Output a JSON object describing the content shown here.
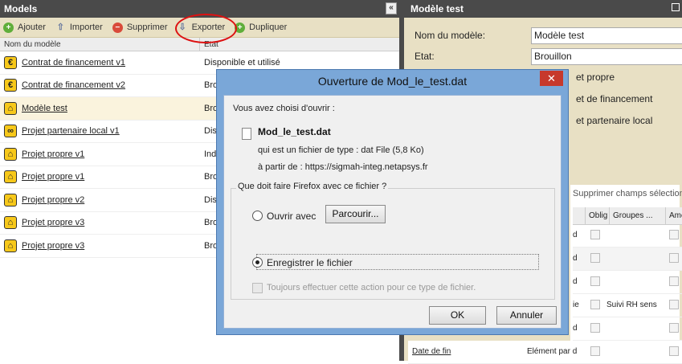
{
  "left_panel": {
    "title": "Models",
    "collapse_glyph": "«",
    "toolbar": [
      {
        "label": "Ajouter",
        "icon": "add-icon",
        "glyph": "+"
      },
      {
        "label": "Importer",
        "icon": "import-icon",
        "glyph": "⇧"
      },
      {
        "label": "Supprimer",
        "icon": "delete-icon",
        "glyph": "−"
      },
      {
        "label": "Exporter",
        "icon": "export-icon",
        "glyph": "⇩"
      },
      {
        "label": "Dupliquer",
        "icon": "duplicate-icon",
        "glyph": "+"
      }
    ],
    "columns": [
      "Nom du modèle",
      "Etat"
    ],
    "rows": [
      {
        "name": "Contrat de financement v1",
        "state": "Disponible et utilisé",
        "icon": "euro-icon",
        "glyph": "€"
      },
      {
        "name": "Contrat de financement v2",
        "state": "Brouillon",
        "icon": "euro-icon",
        "glyph": "€"
      },
      {
        "name": "Modèle test",
        "state": "Brouillon",
        "icon": "house-icon",
        "glyph": "⌂"
      },
      {
        "name": "Projet partenaire local v1",
        "state": "Disponible",
        "icon": "handshake-icon",
        "glyph": "∞"
      },
      {
        "name": "Projet propre v1",
        "state": "Indisponible",
        "icon": "house-icon",
        "glyph": "⌂"
      },
      {
        "name": "Projet propre v1",
        "state": "Brouillon",
        "icon": "house-icon",
        "glyph": "⌂"
      },
      {
        "name": "Projet propre v2",
        "state": "Disponible",
        "icon": "house-icon",
        "glyph": "⌂"
      },
      {
        "name": "Projet propre v3",
        "state": "Brouillon",
        "icon": "house-icon",
        "glyph": "⌂"
      },
      {
        "name": "Projet propre v3",
        "state": "Brouillon",
        "icon": "house-icon",
        "glyph": "⌂"
      }
    ]
  },
  "right_panel": {
    "title": "Modèle test",
    "name_label": "Nom du modèle:",
    "name_value": "Modèle test",
    "state_label": "Etat:",
    "state_value": "Brouillon",
    "type_options": [
      "et propre",
      "et de financement",
      "et partenaire local"
    ],
    "toolbar_text": "Supprimer champs sélection",
    "grid_columns": [
      "",
      "Oblig",
      "Groupes ...",
      "Ame"
    ],
    "grid_rows": [
      {
        "t": "d",
        "v": ""
      },
      {
        "t": "d",
        "v": ""
      },
      {
        "t": "d",
        "v": ""
      },
      {
        "t": "ie",
        "v": "Suivi RH sens"
      },
      {
        "t": "d",
        "v": ""
      }
    ],
    "last_row": {
      "name": "Date de fin",
      "value": "Elément par d"
    }
  },
  "dialog": {
    "title": "Ouverture de Mod_le_test.dat",
    "close_glyph": "✕",
    "intro": "Vous avez choisi d'ouvrir :",
    "file_name": "Mod_le_test.dat",
    "type_text": "qui est un fichier de type :  dat File (5,8 Ko)",
    "source_text": "à partir de :  https://sigmah-integ.netapsys.fr",
    "question": "Que doit faire Firefox avec ce fichier ?",
    "open_with": "Ouvrir avec",
    "browse": "Parcourir...",
    "save_file": "Enregistrer le fichier",
    "always": "Toujours effectuer cette action pour ce type de fichier.",
    "ok": "OK",
    "cancel": "Annuler"
  }
}
